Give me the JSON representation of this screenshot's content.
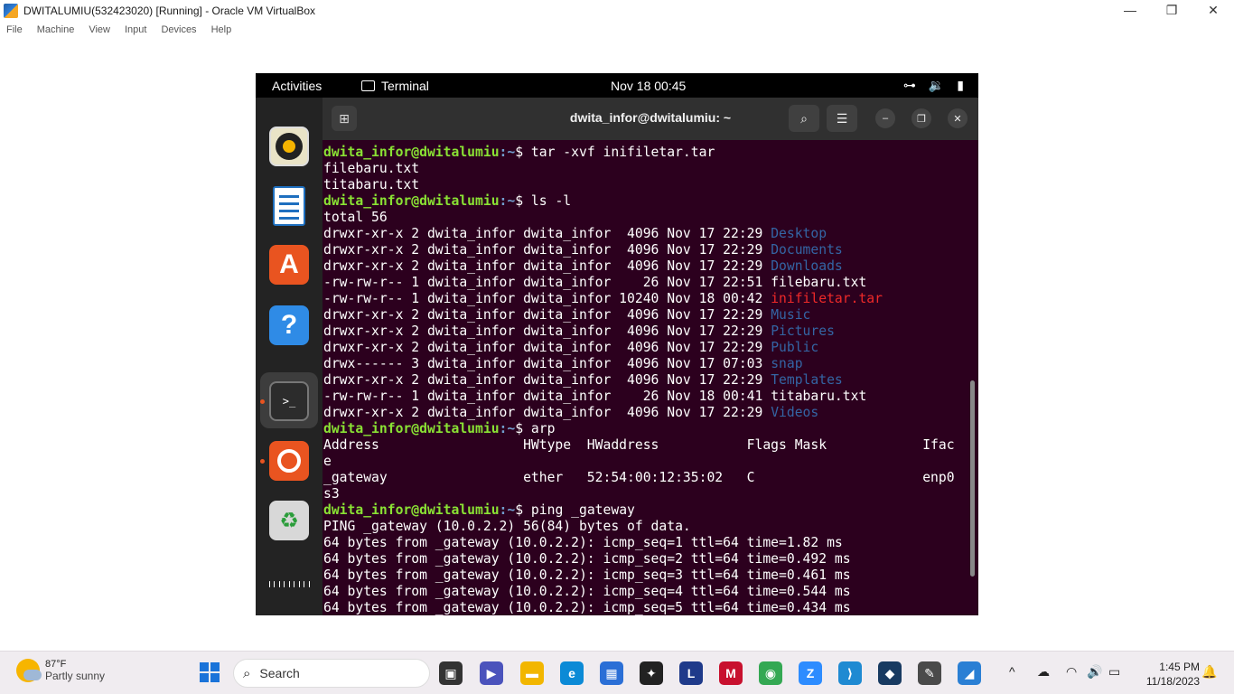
{
  "host": {
    "window_title": "DWITALUMIU(532423020) [Running] - Oracle VM VirtualBox",
    "controls": {
      "minimize": "—",
      "restore": "❐",
      "close": "✕"
    },
    "menu": [
      "File",
      "Machine",
      "View",
      "Input",
      "Devices",
      "Help"
    ]
  },
  "gnome_topbar": {
    "activities": "Activities",
    "app_name": "Terminal",
    "clock": "Nov 18  00:45",
    "tray_icons": [
      "network-icon",
      "volume-icon",
      "battery-icon"
    ]
  },
  "dock": {
    "apps": [
      "rhythmbox-icon",
      "libreoffice-writer-icon",
      "app-center-icon",
      "help-icon",
      "terminal-icon",
      "ubuntu-icon",
      "trash-icon",
      "show-apps-icon"
    ],
    "help_glyph": "?",
    "terminal_glyph": ">_",
    "trash_glyph": "♻"
  },
  "terminal": {
    "title": "dwita_infor@dwitalumiu: ~",
    "prompt_user": "dwita_infor@dwitalumiu",
    "prompt_path": ":~",
    "prompt_suffix": "$ ",
    "lines": [
      {
        "t": "prompt",
        "cmd": "tar -xvf inifiletar.tar"
      },
      {
        "t": "out",
        "text": "filebaru.txt"
      },
      {
        "t": "out",
        "text": "titabaru.txt"
      },
      {
        "t": "prompt",
        "cmd": "ls -l"
      },
      {
        "t": "out",
        "text": "total 56"
      },
      {
        "t": "ls",
        "meta": "drwxr-xr-x 2 dwita_infor dwita_infor  4096 Nov 17 22:29 ",
        "name": "Desktop",
        "kind": "dir"
      },
      {
        "t": "ls",
        "meta": "drwxr-xr-x 2 dwita_infor dwita_infor  4096 Nov 17 22:29 ",
        "name": "Documents",
        "kind": "dir"
      },
      {
        "t": "ls",
        "meta": "drwxr-xr-x 2 dwita_infor dwita_infor  4096 Nov 17 22:29 ",
        "name": "Downloads",
        "kind": "dir"
      },
      {
        "t": "ls",
        "meta": "-rw-rw-r-- 1 dwita_infor dwita_infor    26 Nov 17 22:51 ",
        "name": "filebaru.txt",
        "kind": "file"
      },
      {
        "t": "ls",
        "meta": "-rw-rw-r-- 1 dwita_infor dwita_infor 10240 Nov 18 00:42 ",
        "name": "inifiletar.tar",
        "kind": "arch"
      },
      {
        "t": "ls",
        "meta": "drwxr-xr-x 2 dwita_infor dwita_infor  4096 Nov 17 22:29 ",
        "name": "Music",
        "kind": "dir"
      },
      {
        "t": "ls",
        "meta": "drwxr-xr-x 2 dwita_infor dwita_infor  4096 Nov 17 22:29 ",
        "name": "Pictures",
        "kind": "dir"
      },
      {
        "t": "ls",
        "meta": "drwxr-xr-x 2 dwita_infor dwita_infor  4096 Nov 17 22:29 ",
        "name": "Public",
        "kind": "dir"
      },
      {
        "t": "ls",
        "meta": "drwx------ 3 dwita_infor dwita_infor  4096 Nov 17 07:03 ",
        "name": "snap",
        "kind": "dir"
      },
      {
        "t": "ls",
        "meta": "drwxr-xr-x 2 dwita_infor dwita_infor  4096 Nov 17 22:29 ",
        "name": "Templates",
        "kind": "dir"
      },
      {
        "t": "ls",
        "meta": "-rw-rw-r-- 1 dwita_infor dwita_infor    26 Nov 18 00:41 ",
        "name": "titabaru.txt",
        "kind": "file"
      },
      {
        "t": "ls",
        "meta": "drwxr-xr-x 2 dwita_infor dwita_infor  4096 Nov 17 22:29 ",
        "name": "Videos",
        "kind": "dir"
      },
      {
        "t": "prompt",
        "cmd": "arp"
      },
      {
        "t": "out",
        "text": "Address                  HWtype  HWaddress           Flags Mask            Ifac"
      },
      {
        "t": "out",
        "text": "e"
      },
      {
        "t": "out",
        "text": "_gateway                 ether   52:54:00:12:35:02   C                     enp0"
      },
      {
        "t": "out",
        "text": "s3"
      },
      {
        "t": "prompt",
        "cmd": "ping _gateway"
      },
      {
        "t": "out",
        "text": "PING _gateway (10.0.2.2) 56(84) bytes of data."
      },
      {
        "t": "out",
        "text": "64 bytes from _gateway (10.0.2.2): icmp_seq=1 ttl=64 time=1.82 ms"
      },
      {
        "t": "out",
        "text": "64 bytes from _gateway (10.0.2.2): icmp_seq=2 ttl=64 time=0.492 ms"
      },
      {
        "t": "out",
        "text": "64 bytes from _gateway (10.0.2.2): icmp_seq=3 ttl=64 time=0.461 ms"
      },
      {
        "t": "out",
        "text": "64 bytes from _gateway (10.0.2.2): icmp_seq=4 ttl=64 time=0.544 ms"
      },
      {
        "t": "out",
        "text": "64 bytes from _gateway (10.0.2.2): icmp_seq=5 ttl=64 time=0.434 ms"
      }
    ]
  },
  "taskbar": {
    "weather_temp": "87°F",
    "weather_cond": "Partly sunny",
    "search_placeholder": "Search",
    "apps": [
      {
        "name": "task-view-icon",
        "glyph": "▣",
        "color": "#333333"
      },
      {
        "name": "teams-icon",
        "glyph": "▶",
        "color": "#4b53bc"
      },
      {
        "name": "file-explorer-icon",
        "glyph": "▬",
        "color": "#f2b600"
      },
      {
        "name": "edge-icon",
        "glyph": "e",
        "color": "#0c8ad6"
      },
      {
        "name": "ms-store-icon",
        "glyph": "▦",
        "color": "#2b6fd6"
      },
      {
        "name": "dropbox-icon",
        "glyph": "✦",
        "color": "#222222"
      },
      {
        "name": "l-app-icon",
        "glyph": "L",
        "color": "#1f3a8a"
      },
      {
        "name": "mcafee-icon",
        "glyph": "M",
        "color": "#c8102e"
      },
      {
        "name": "chrome-icon",
        "glyph": "◉",
        "color": "#34a853"
      },
      {
        "name": "zoom-icon",
        "glyph": "Z",
        "color": "#2d8cff"
      },
      {
        "name": "vscode-icon",
        "glyph": "⟩",
        "color": "#1f8ad2"
      },
      {
        "name": "virtualbox-icon",
        "glyph": "◆",
        "color": "#183a61"
      },
      {
        "name": "csharp-app-icon",
        "glyph": "✎",
        "color": "#4a4a4a"
      },
      {
        "name": "app-icon",
        "glyph": "◢",
        "color": "#2a7fd4"
      }
    ],
    "tray": {
      "chevron": "^",
      "cloud": "☁",
      "wifi": "◠",
      "volume": "🔊",
      "battery": "▭"
    },
    "time": "1:45 PM",
    "date": "11/18/2023"
  }
}
